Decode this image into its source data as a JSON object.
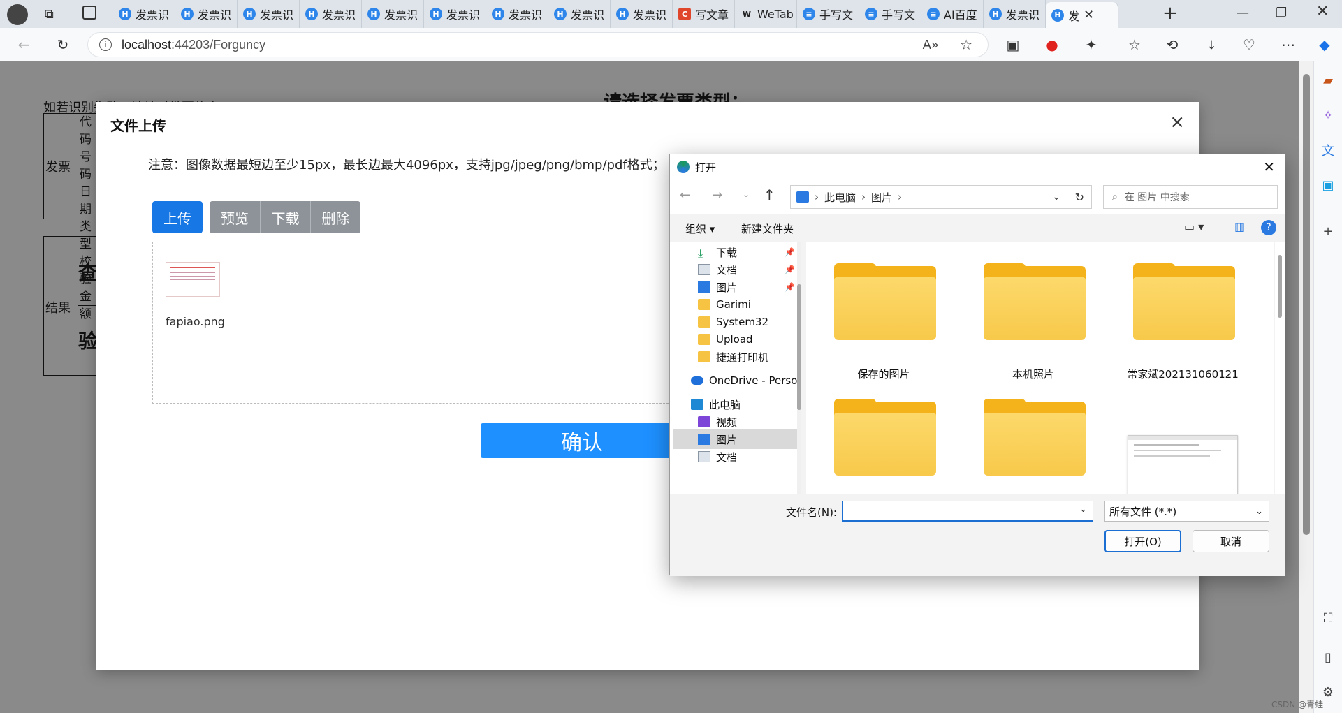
{
  "browser": {
    "tabs": [
      {
        "icon": "H",
        "label": "发票识"
      },
      {
        "icon": "H",
        "label": "发票识"
      },
      {
        "icon": "H",
        "label": "发票识"
      },
      {
        "icon": "H",
        "label": "发票识"
      },
      {
        "icon": "H",
        "label": "发票识"
      },
      {
        "icon": "H",
        "label": "发票识"
      },
      {
        "icon": "H",
        "label": "发票识"
      },
      {
        "icon": "H",
        "label": "发票识"
      },
      {
        "icon": "H",
        "label": "发票识"
      },
      {
        "icon": "C",
        "label": "写文章"
      },
      {
        "icon": "W",
        "label": "WeTab"
      },
      {
        "icon": "≡",
        "label": "手写文"
      },
      {
        "icon": "≡",
        "label": "手写文"
      },
      {
        "icon": "≡",
        "label": "AI百度"
      },
      {
        "icon": "H",
        "label": "发票识"
      },
      {
        "icon": "H",
        "label": "发"
      }
    ],
    "url_host": "localhost",
    "url_rest": ":44203/Forguncy"
  },
  "page": {
    "top_hint": "如若识别失败，请核对发票信息",
    "heading": "请选择发票类型：",
    "table1_label": "发票",
    "table1_rows": [
      "代码",
      "号码",
      "日期",
      "类型",
      "校验",
      "金额"
    ],
    "table2_label": "结果",
    "table2_items": [
      "查",
      "验"
    ]
  },
  "modal": {
    "title": "文件上传",
    "close": "×",
    "notice": "注意：图像数据最短边至少15px，最长边最大4096px，支持jpg/jpeg/png/bmp/pdf格式；",
    "buttons": {
      "upload": "上传",
      "preview": "预览",
      "download": "下载",
      "delete": "删除"
    },
    "file_name": "fapiao.png",
    "confirm": "确认"
  },
  "dialog": {
    "title": "打开",
    "breadcrumb": [
      "此电脑",
      "图片"
    ],
    "search_placeholder": "在 图片 中搜索",
    "organize": "组织",
    "new_folder": "新建文件夹",
    "tree": [
      {
        "label": "下载",
        "pinned": true
      },
      {
        "label": "文档",
        "pinned": true
      },
      {
        "label": "图片",
        "pinned": true
      },
      {
        "label": "Garimi",
        "pinned": false
      },
      {
        "label": "System32",
        "pinned": false
      },
      {
        "label": "Upload",
        "pinned": false
      },
      {
        "label": "捷通打印机",
        "pinned": false
      },
      {
        "label": "OneDrive - Perso",
        "pinned": false
      },
      {
        "label": "此电脑",
        "pinned": false
      },
      {
        "label": "视频",
        "pinned": false
      },
      {
        "label": "图片",
        "pinned": false,
        "selected": true
      },
      {
        "label": "文档",
        "pinned": false
      }
    ],
    "folders": [
      {
        "name": "保存的图片"
      },
      {
        "name": "本机照片"
      },
      {
        "name": "常家斌202131060121"
      },
      {
        "name": ""
      },
      {
        "name": ""
      }
    ],
    "filename_label": "文件名(N):",
    "filename_value": "",
    "filter": "所有文件 (*.*)",
    "open_btn": "打开(O)",
    "cancel_btn": "取消"
  },
  "watermark": "CSDN @青蛙"
}
